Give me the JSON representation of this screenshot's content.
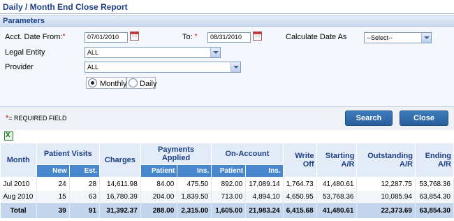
{
  "page": {
    "title": "Daily / Month End Close Report"
  },
  "parameters": {
    "header": "Parameters",
    "acct_date_from": {
      "label": "Acct. Date From:",
      "value": "07/01/2010"
    },
    "to": {
      "label": "To:",
      "value": "08/31/2010"
    },
    "calculate_date_as": {
      "label": "Calculate Date As",
      "value": "--Select--"
    },
    "legal_entity": {
      "label": "Legal Entity",
      "value": "ALL"
    },
    "provider": {
      "label": "Provider",
      "value": "ALL"
    },
    "period": {
      "monthly_label": "Monthly",
      "daily_label": "Daily",
      "selected": "Monthly"
    },
    "required_star": "*"
  },
  "footer": {
    "required_note": "= REQUIRED FIELD",
    "search_label": "Search",
    "close_label": "Close"
  },
  "icons": {
    "export": "excel-export-icon",
    "calendar": "calendar-icon"
  },
  "colors": {
    "accent": "#2a5e9d",
    "header_text": "#1d3f86",
    "sub_header": "#4787ce",
    "total_row": "#c3d6ee"
  },
  "table": {
    "headers": {
      "month": "Month",
      "patient_visits": "Patient Visits",
      "new": "New",
      "est": "Est.",
      "charges": "Charges",
      "payments_applied": "Payments Applied",
      "payments_patient": "Patient",
      "payments_ins": "Ins.",
      "on_account": "On-Account",
      "onacct_patient": "Patient",
      "onacct_ins": "Ins.",
      "write_off": "Write Off",
      "starting_ar": "Starting A/R",
      "outstanding_ar": "Outstanding A/R",
      "ending_ar": "Ending A/R"
    },
    "rows": [
      {
        "month": "Jul 2010",
        "new": "24",
        "est": "28",
        "charges": "14,611.98",
        "pay_patient": "84.00",
        "pay_ins": "475.50",
        "oa_patient": "892.00",
        "oa_ins": "17,089.14",
        "write_off": "1,764.73",
        "starting_ar": "41,480.61",
        "outstanding_ar": "12,287.75",
        "ending_ar": "53,768.36"
      },
      {
        "month": "Aug 2010",
        "new": "15",
        "est": "63",
        "charges": "16,780.39",
        "pay_patient": "204.00",
        "pay_ins": "1,839.50",
        "oa_patient": "713.00",
        "oa_ins": "4,894.10",
        "write_off": "4,650.95",
        "starting_ar": "53,768.36",
        "outstanding_ar": "10,085.94",
        "ending_ar": "63,854.30"
      }
    ],
    "total": {
      "label": "Total",
      "new": "39",
      "est": "91",
      "charges": "31,392.37",
      "pay_patient": "288.00",
      "pay_ins": "2,315.00",
      "oa_patient": "1,605.00",
      "oa_ins": "21,983.24",
      "write_off": "6,415.68",
      "starting_ar": "41,480.61",
      "outstanding_ar": "22,373.69",
      "ending_ar": "63,854.30"
    }
  }
}
